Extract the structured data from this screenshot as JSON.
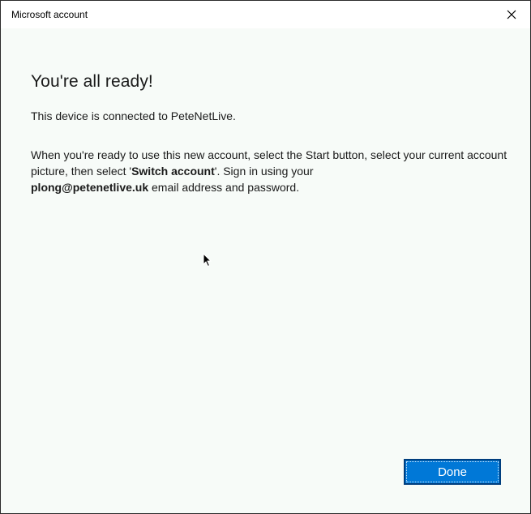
{
  "window": {
    "title": "Microsoft account",
    "close_icon": "close-icon"
  },
  "main": {
    "heading": "You're all ready!",
    "connected_text": "This device is connected to PeteNetLive.",
    "instructions": {
      "part1": "When you're ready to use this new account, select the Start button, select your current account picture, then select '",
      "switch_account": "Switch account",
      "part2": "'. Sign in using your ",
      "email": "plong@petenetlive.uk",
      "part3": " email address and password."
    }
  },
  "footer": {
    "done_label": "Done"
  },
  "colors": {
    "accent": "#0078d7",
    "background": "#f7fbf8"
  }
}
